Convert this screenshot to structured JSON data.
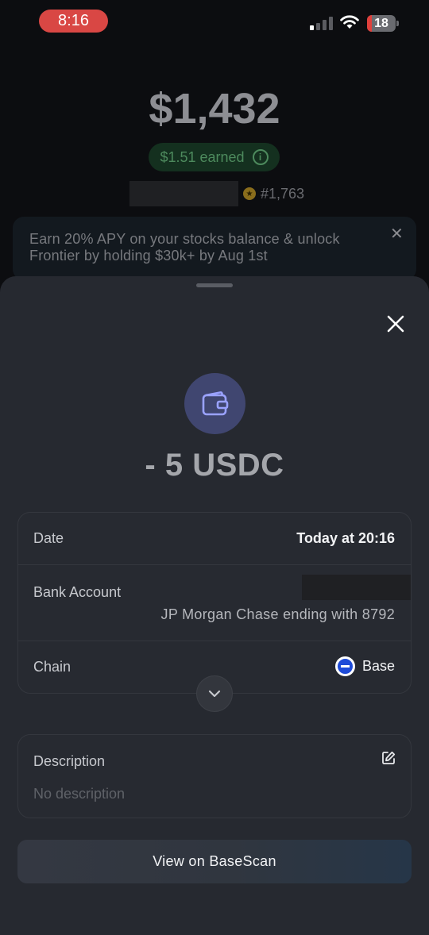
{
  "status_bar": {
    "time": "8:16",
    "battery": "18",
    "battery_level": 0.18
  },
  "background": {
    "balance": "$1,432",
    "earned": "$1.51 earned",
    "rank": "#1,763",
    "banner_text": "Earn 20% APY on your stocks balance & unlock Frontier by holding $30k+ by Aug 1st"
  },
  "sheet": {
    "amount": "- 5 USDC",
    "details": {
      "date_label": "Date",
      "date_value": "Today at 20:16",
      "bank_label": "Bank Account",
      "bank_value": "JP Morgan Chase ending with 8792",
      "chain_label": "Chain",
      "chain_value": "Base"
    },
    "description": {
      "label": "Description",
      "placeholder": "No description"
    },
    "scan_button": "View on BaseScan"
  },
  "colors": {
    "sheet_bg": "#262930",
    "accent_purple": "#404670",
    "base_blue": "#1e4bd8",
    "earned_green": "#4d8a5d",
    "time_red": "#d94744"
  },
  "icons": [
    "wallet-icon",
    "close-icon",
    "chevron-down-icon",
    "edit-icon",
    "info-icon",
    "wifi-icon",
    "base-chain-icon"
  ]
}
